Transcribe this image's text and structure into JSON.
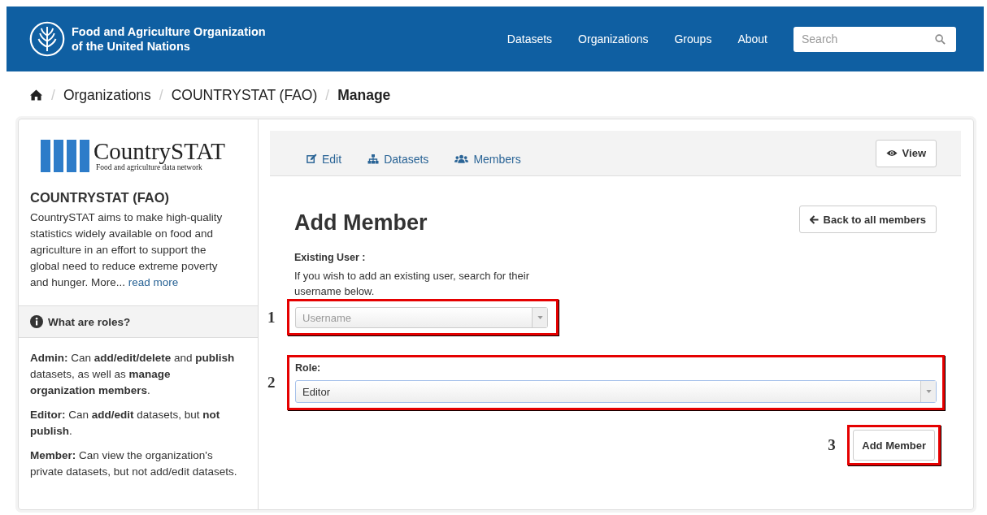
{
  "header": {
    "org_name": [
      "Food and Agriculture Organization",
      "of the United Nations"
    ],
    "nav": [
      {
        "label": "Datasets"
      },
      {
        "label": "Organizations"
      },
      {
        "label": "Groups"
      },
      {
        "label": "About"
      }
    ],
    "search": {
      "placeholder": "Search"
    }
  },
  "breadcrumb": [
    {
      "separator": "/",
      "label": "Organizations",
      "current": false
    },
    {
      "separator": "/",
      "label": "COUNTRYSTAT (FAO)",
      "current": false
    },
    {
      "separator": "/",
      "label": "Manage",
      "current": true
    }
  ],
  "sidebar": {
    "logo": {
      "name": "CountrySTAT",
      "tagline": "Food and agriculture data network"
    },
    "title": "COUNTRYSTAT (FAO)",
    "description": "CountrySTAT aims to make high-quality statistics widely available on food and agriculture in an effort to support the global need to reduce extreme poverty and hunger. More...",
    "read_more": "read more",
    "roles_heading": "What are roles?",
    "roles": [
      "**Admin:** Can **add/edit/delete** and **publish** datasets, as well as **manage organization members**.",
      "**Editor:** Can **add/edit** datasets, but **not publish**.",
      "**Member:** Can view the organization's private datasets, but not add/edit datasets."
    ]
  },
  "tabs": [
    {
      "label": "Edit"
    },
    {
      "label": "Datasets"
    },
    {
      "label": "Members"
    }
  ],
  "view_button": "View",
  "form": {
    "title": "Add Member",
    "back_button": "Back to all members",
    "existing_user_label": "Existing User :",
    "existing_user_help": "If you wish to add an existing user, search for their username below.",
    "username": {
      "placeholder": "Username"
    },
    "role_label": "Role:",
    "role": {
      "value": "Editor"
    },
    "submit": "Add Member"
  },
  "annotations": [
    {
      "label": "1"
    },
    {
      "label": "2"
    },
    {
      "label": "3"
    }
  ]
}
